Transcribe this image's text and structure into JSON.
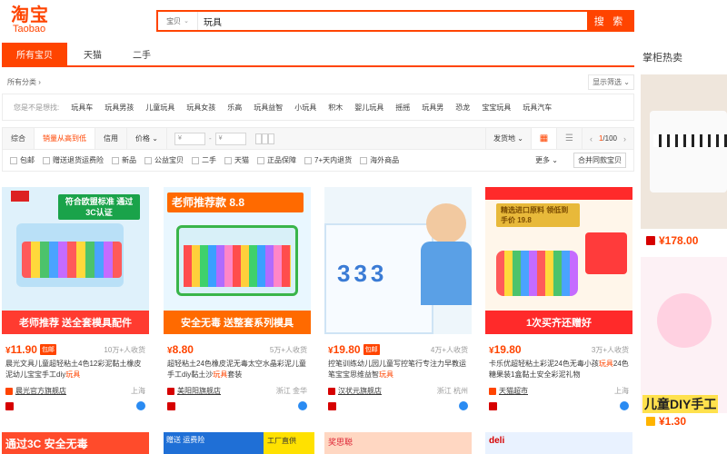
{
  "header": {
    "logo_zh": "淘宝",
    "logo_en": "Taobao",
    "search_category": "宝贝",
    "search_value": "玩具",
    "search_button": "搜 索"
  },
  "tabs": [
    {
      "label": "所有宝贝",
      "active": true
    },
    {
      "label": "天猫",
      "active": false
    },
    {
      "label": "二手",
      "active": false
    }
  ],
  "right_title": "掌柜热卖",
  "category_row": {
    "all_categories": "所有分类 ›",
    "display_filter": "显示筛选 ⌄"
  },
  "did_you_mean": {
    "label": "您是不是想找:",
    "keywords": [
      "玩具车",
      "玩具男孩",
      "儿童玩具",
      "玩具女孩",
      "乐高",
      "玩具益智",
      "小玩具",
      "积木",
      "婴儿玩具",
      "摇摇",
      "玩具男",
      "恐龙",
      "宝宝玩具",
      "玩具汽车"
    ]
  },
  "sort_bar": {
    "items": [
      {
        "label": "综合",
        "active": false
      },
      {
        "label": "销量从高到低",
        "active": true
      },
      {
        "label": "信用",
        "active": false
      },
      {
        "label": "价格 ⌄",
        "active": false
      }
    ],
    "price_from": "¥",
    "price_to": "¥",
    "ship_from": "发货地 ⌄",
    "page_current": "1",
    "page_total": "/100"
  },
  "checks": [
    "包邮",
    "赠送退货运费险",
    "新品",
    "公益宝贝",
    "二手",
    "天猫",
    "正品保障",
    "7+天内退货",
    "海外商品"
  ],
  "more_label": "更多 ⌄",
  "merge_label": "合并同款宝贝",
  "products": [
    {
      "price": "11.90",
      "badge": "包邮",
      "sales": "10万+人收货",
      "title_pre": "晨光文具儿童超轻粘土4色12彩泥黏土橡皮泥幼儿宝宝手工diy",
      "title_hl": "玩具",
      "title_post": "",
      "shop": "晨光官方旗舰店",
      "location": "上海",
      "band": "老师推荐  送全套模具配件",
      "tag": "符合欧盟标准 通过3C认证",
      "colors": {
        "bg": "#dff1fb",
        "band": "#ff3b30"
      }
    },
    {
      "price": "8.80",
      "badge": "",
      "sales": "5万+人收货",
      "title_pre": "超轻粘土24色橡皮泥无毒太空水晶彩泥儿童手工diy黏土沙",
      "title_hl": "玩具",
      "title_post": "套装",
      "shop": "美阳阳旗舰店",
      "location": "浙江 金华",
      "band": "安全无毒  送整套系列模具",
      "tag": "老师推荐款 8.8",
      "colors": {
        "bg": "#e9f7ff",
        "band": "#ff6a00"
      }
    },
    {
      "price": "19.80",
      "badge": "包邮",
      "sales": "4万+人收货",
      "title_pre": "控笔训练幼儿园儿童写控笔行专注力早教运笔宝宝思维益智",
      "title_hl": "玩具",
      "title_post": "",
      "shop": "汉状元旗舰店",
      "location": "浙江 杭州",
      "band": "",
      "tag": "",
      "colors": {
        "bg": "#eef6fb",
        "band": "#3a7bd5"
      }
    },
    {
      "price": "19.80",
      "badge": "",
      "sales": "3万+人收货",
      "title_pre": "卡乐优超轻粘土彩泥24色无毒小孩",
      "title_hl": "玩具",
      "title_post": "24色糖果装1盒黏土安全彩泥礼物",
      "shop": "天猫超市",
      "location": "上海",
      "band": "1次买齐还赠好",
      "tag": "精选进口原料 领低到手价 19.8",
      "colors": {
        "bg": "#fff6ea",
        "band": "#ff2a2a"
      }
    }
  ],
  "recommend": [
    {
      "price": "¥178.00",
      "label": ""
    },
    {
      "price": "¥1.30",
      "label": "儿童DIY手工"
    }
  ],
  "bottom_row": [
    "通过3C 安全无毒",
    "赠送 运费险",
    "工厂直供",
    "奖思聪",
    "deli"
  ]
}
